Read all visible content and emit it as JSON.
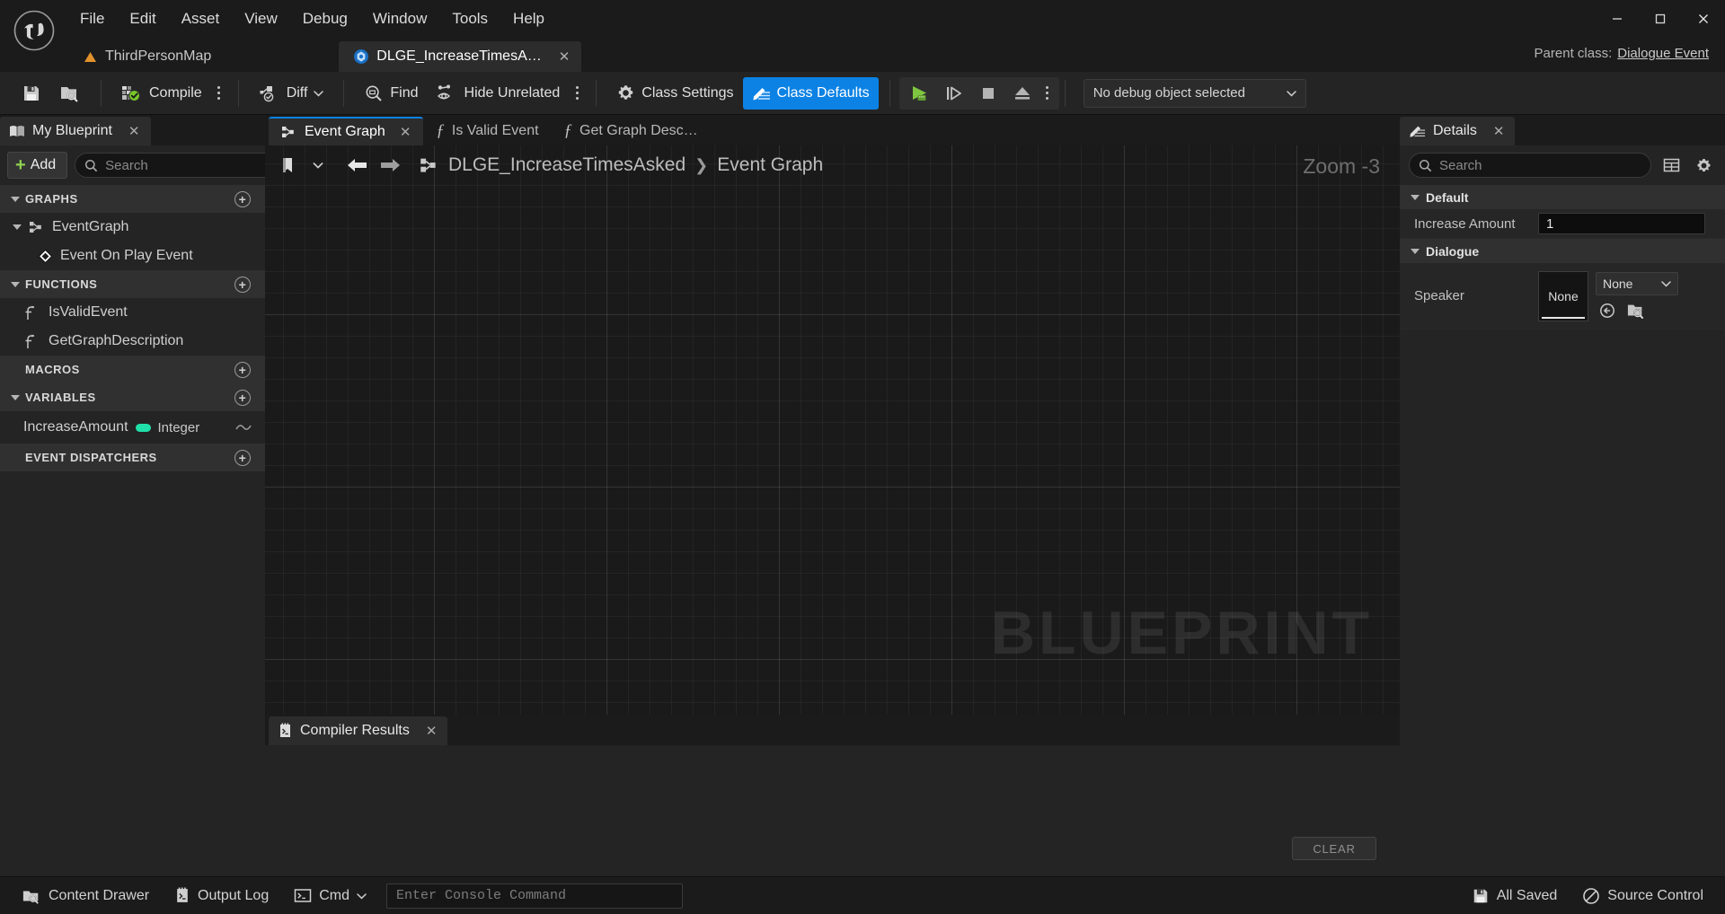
{
  "window": {
    "app_logo": "unreal-engine-logo",
    "minimize": "–",
    "maximize": "▢",
    "close": "✕"
  },
  "menubar": {
    "items": [
      {
        "label": "File"
      },
      {
        "label": "Edit"
      },
      {
        "label": "Asset"
      },
      {
        "label": "View"
      },
      {
        "label": "Debug"
      },
      {
        "label": "Window"
      },
      {
        "label": "Tools"
      },
      {
        "label": "Help"
      }
    ]
  },
  "asset_tabs": {
    "tabs": [
      {
        "label": "ThirdPersonMap",
        "icon": "level-icon",
        "active": false,
        "closable": false
      },
      {
        "label": "DLGE_IncreaseTimesA…",
        "icon": "blueprint-icon",
        "active": true,
        "closable": true
      }
    ],
    "parent_class_label": "Parent class:",
    "parent_class_value": "Dialogue Event"
  },
  "toolbar": {
    "save_icon": "save-icon",
    "browse_icon": "browse-content-icon",
    "compile_label": "Compile",
    "diff_label": "Diff",
    "find_label": "Find",
    "hide_unrelated_label": "Hide Unrelated",
    "class_settings_label": "Class Settings",
    "class_defaults_label": "Class Defaults",
    "class_defaults_active": true,
    "accent_color": "#0c82e4",
    "play_label": "Play",
    "step_label": "Step",
    "stop_label": "Stop",
    "eject_label": "Eject",
    "debug_object_label": "No debug object selected"
  },
  "my_blueprint": {
    "tab_label": "My Blueprint",
    "tab_icon": "book-icon",
    "add_label": "Add",
    "search_placeholder": "Search",
    "search_value": "",
    "settings_icon": "gear-icon",
    "sections": [
      {
        "title": "GRAPHS",
        "collapsible": true,
        "has_add": true,
        "items": [
          {
            "label": "EventGraph",
            "icon": "event-graph-icon",
            "indent": 1,
            "expandable": true
          },
          {
            "label": "Event On Play Event",
            "icon": "event-node-icon",
            "indent": 2,
            "expandable": false
          }
        ]
      },
      {
        "title": "FUNCTIONS",
        "collapsible": true,
        "has_add": true,
        "items": [
          {
            "label": "IsValidEvent",
            "icon": "function-icon",
            "indent": 1,
            "expandable": false
          },
          {
            "label": "GetGraphDescription",
            "icon": "function-icon",
            "indent": 1,
            "expandable": false
          }
        ]
      },
      {
        "title": "MACROS",
        "collapsible": false,
        "has_add": true,
        "items": []
      },
      {
        "title": "VARIABLES",
        "collapsible": true,
        "has_add": true,
        "items": [
          {
            "label": "IncreaseAmount",
            "type": "Integer",
            "type_color": "#1fe0a8",
            "indent": 1,
            "expandable": false
          }
        ]
      },
      {
        "title": "EVENT DISPATCHERS",
        "collapsible": false,
        "has_add": true,
        "items": []
      }
    ]
  },
  "graph": {
    "tabs": [
      {
        "label": "Event Graph",
        "icon": "event-graph-icon",
        "active": true,
        "closable": true
      },
      {
        "label": "Is Valid Event",
        "icon": "function-icon",
        "active": false,
        "closable": false
      },
      {
        "label": "Get Graph Desc…",
        "icon": "function-icon",
        "active": false,
        "closable": false
      }
    ],
    "bookmark_icon": "bookmark-icon",
    "back_icon": "arrow-left-icon",
    "forward_icon": "arrow-right-icon",
    "breadcrumb_icon": "event-graph-icon",
    "breadcrumb": [
      "DLGE_IncreaseTimesAsked",
      "Event Graph"
    ],
    "breadcrumb_separator": "❯",
    "zoom_label": "Zoom -3",
    "watermark": "BLUEPRINT"
  },
  "compiler_results": {
    "tab_label": "Compiler Results",
    "tab_icon": "compiler-log-icon",
    "clear_label": "CLEAR",
    "messages": []
  },
  "details": {
    "tab_label": "Details",
    "tab_icon": "details-icon",
    "search_placeholder": "Search",
    "search_value": "",
    "grid_icon": "column-layout-icon",
    "settings_icon": "gear-icon",
    "categories": [
      {
        "title": "Default",
        "properties": [
          {
            "label": "Increase Amount",
            "type": "number",
            "value": "1"
          }
        ]
      },
      {
        "title": "Dialogue",
        "properties": [
          {
            "label": "Speaker",
            "type": "object",
            "thumbnail_text": "None",
            "value": "None",
            "browse_icon": "browse-icon",
            "use_selected_icon": "use-selected-icon"
          }
        ]
      }
    ]
  },
  "statusbar": {
    "content_drawer_label": "Content Drawer",
    "content_drawer_icon": "drawer-icon",
    "output_log_label": "Output Log",
    "output_log_icon": "log-icon",
    "cmd_label": "Cmd",
    "cmd_icon": "console-icon",
    "console_placeholder": "Enter Console Command",
    "console_value": "",
    "all_saved_label": "All Saved",
    "all_saved_icon": "save-status-icon",
    "source_control_label": "Source Control",
    "source_control_icon": "source-control-icon"
  }
}
